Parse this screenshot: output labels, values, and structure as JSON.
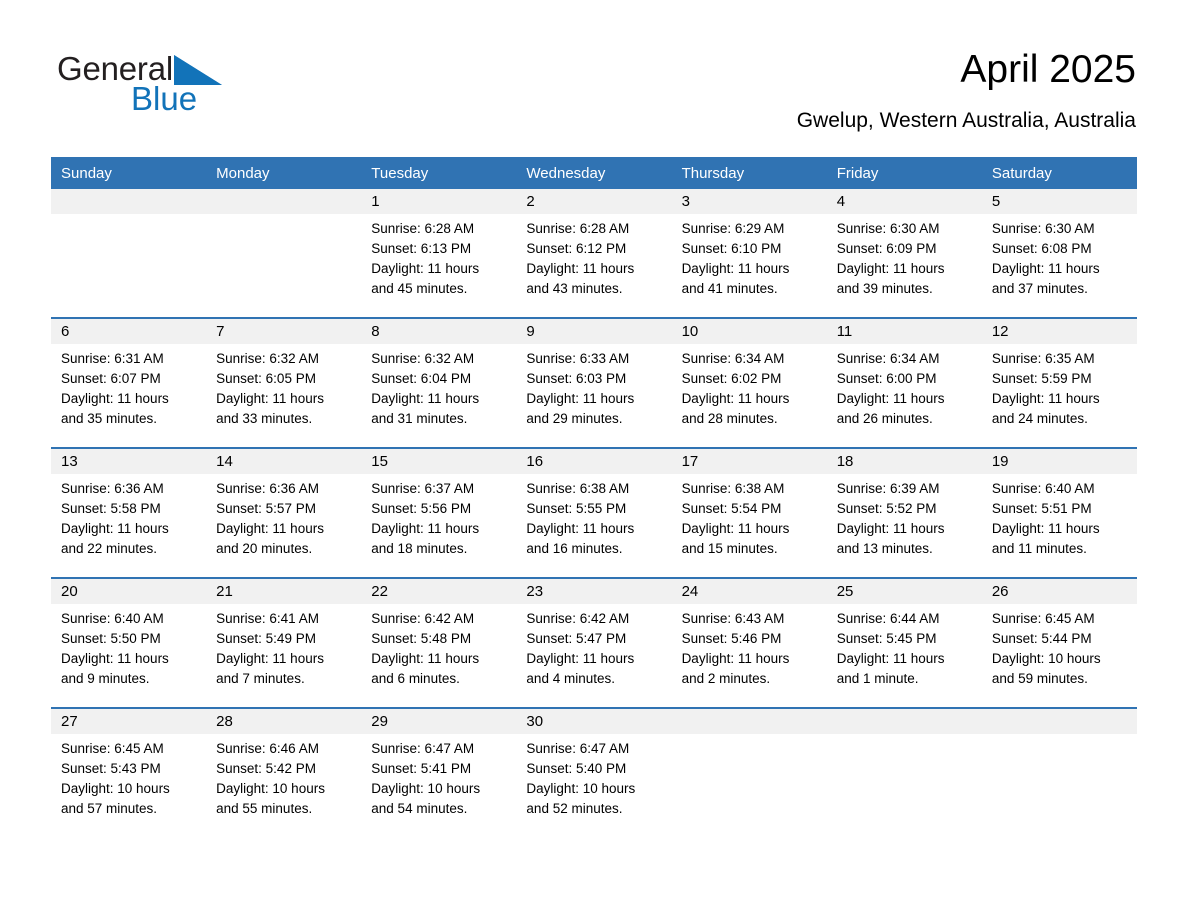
{
  "brand": {
    "name_part1": "General",
    "name_part2": "Blue",
    "triangle_color": "#1273b9",
    "text_color": "#231f20"
  },
  "header": {
    "title": "April 2025",
    "location": "Gwelup, Western Australia, Australia"
  },
  "theme": {
    "header_blue": "#3073b3",
    "daynum_band": "#f1f1f1",
    "separator_blue": "#3073b3"
  },
  "calendar": {
    "weekday_headers": [
      "Sunday",
      "Monday",
      "Tuesday",
      "Wednesday",
      "Thursday",
      "Friday",
      "Saturday"
    ],
    "weeks": [
      [
        {
          "day": "",
          "sunrise": "",
          "sunset": "",
          "daylight": ""
        },
        {
          "day": "",
          "sunrise": "",
          "sunset": "",
          "daylight": ""
        },
        {
          "day": "1",
          "sunrise": "Sunrise: 6:28 AM",
          "sunset": "Sunset: 6:13 PM",
          "daylight": "Daylight: 11 hours and 45 minutes."
        },
        {
          "day": "2",
          "sunrise": "Sunrise: 6:28 AM",
          "sunset": "Sunset: 6:12 PM",
          "daylight": "Daylight: 11 hours and 43 minutes."
        },
        {
          "day": "3",
          "sunrise": "Sunrise: 6:29 AM",
          "sunset": "Sunset: 6:10 PM",
          "daylight": "Daylight: 11 hours and 41 minutes."
        },
        {
          "day": "4",
          "sunrise": "Sunrise: 6:30 AM",
          "sunset": "Sunset: 6:09 PM",
          "daylight": "Daylight: 11 hours and 39 minutes."
        },
        {
          "day": "5",
          "sunrise": "Sunrise: 6:30 AM",
          "sunset": "Sunset: 6:08 PM",
          "daylight": "Daylight: 11 hours and 37 minutes."
        }
      ],
      [
        {
          "day": "6",
          "sunrise": "Sunrise: 6:31 AM",
          "sunset": "Sunset: 6:07 PM",
          "daylight": "Daylight: 11 hours and 35 minutes."
        },
        {
          "day": "7",
          "sunrise": "Sunrise: 6:32 AM",
          "sunset": "Sunset: 6:05 PM",
          "daylight": "Daylight: 11 hours and 33 minutes."
        },
        {
          "day": "8",
          "sunrise": "Sunrise: 6:32 AM",
          "sunset": "Sunset: 6:04 PM",
          "daylight": "Daylight: 11 hours and 31 minutes."
        },
        {
          "day": "9",
          "sunrise": "Sunrise: 6:33 AM",
          "sunset": "Sunset: 6:03 PM",
          "daylight": "Daylight: 11 hours and 29 minutes."
        },
        {
          "day": "10",
          "sunrise": "Sunrise: 6:34 AM",
          "sunset": "Sunset: 6:02 PM",
          "daylight": "Daylight: 11 hours and 28 minutes."
        },
        {
          "day": "11",
          "sunrise": "Sunrise: 6:34 AM",
          "sunset": "Sunset: 6:00 PM",
          "daylight": "Daylight: 11 hours and 26 minutes."
        },
        {
          "day": "12",
          "sunrise": "Sunrise: 6:35 AM",
          "sunset": "Sunset: 5:59 PM",
          "daylight": "Daylight: 11 hours and 24 minutes."
        }
      ],
      [
        {
          "day": "13",
          "sunrise": "Sunrise: 6:36 AM",
          "sunset": "Sunset: 5:58 PM",
          "daylight": "Daylight: 11 hours and 22 minutes."
        },
        {
          "day": "14",
          "sunrise": "Sunrise: 6:36 AM",
          "sunset": "Sunset: 5:57 PM",
          "daylight": "Daylight: 11 hours and 20 minutes."
        },
        {
          "day": "15",
          "sunrise": "Sunrise: 6:37 AM",
          "sunset": "Sunset: 5:56 PM",
          "daylight": "Daylight: 11 hours and 18 minutes."
        },
        {
          "day": "16",
          "sunrise": "Sunrise: 6:38 AM",
          "sunset": "Sunset: 5:55 PM",
          "daylight": "Daylight: 11 hours and 16 minutes."
        },
        {
          "day": "17",
          "sunrise": "Sunrise: 6:38 AM",
          "sunset": "Sunset: 5:54 PM",
          "daylight": "Daylight: 11 hours and 15 minutes."
        },
        {
          "day": "18",
          "sunrise": "Sunrise: 6:39 AM",
          "sunset": "Sunset: 5:52 PM",
          "daylight": "Daylight: 11 hours and 13 minutes."
        },
        {
          "day": "19",
          "sunrise": "Sunrise: 6:40 AM",
          "sunset": "Sunset: 5:51 PM",
          "daylight": "Daylight: 11 hours and 11 minutes."
        }
      ],
      [
        {
          "day": "20",
          "sunrise": "Sunrise: 6:40 AM",
          "sunset": "Sunset: 5:50 PM",
          "daylight": "Daylight: 11 hours and 9 minutes."
        },
        {
          "day": "21",
          "sunrise": "Sunrise: 6:41 AM",
          "sunset": "Sunset: 5:49 PM",
          "daylight": "Daylight: 11 hours and 7 minutes."
        },
        {
          "day": "22",
          "sunrise": "Sunrise: 6:42 AM",
          "sunset": "Sunset: 5:48 PM",
          "daylight": "Daylight: 11 hours and 6 minutes."
        },
        {
          "day": "23",
          "sunrise": "Sunrise: 6:42 AM",
          "sunset": "Sunset: 5:47 PM",
          "daylight": "Daylight: 11 hours and 4 minutes."
        },
        {
          "day": "24",
          "sunrise": "Sunrise: 6:43 AM",
          "sunset": "Sunset: 5:46 PM",
          "daylight": "Daylight: 11 hours and 2 minutes."
        },
        {
          "day": "25",
          "sunrise": "Sunrise: 6:44 AM",
          "sunset": "Sunset: 5:45 PM",
          "daylight": "Daylight: 11 hours and 1 minute."
        },
        {
          "day": "26",
          "sunrise": "Sunrise: 6:45 AM",
          "sunset": "Sunset: 5:44 PM",
          "daylight": "Daylight: 10 hours and 59 minutes."
        }
      ],
      [
        {
          "day": "27",
          "sunrise": "Sunrise: 6:45 AM",
          "sunset": "Sunset: 5:43 PM",
          "daylight": "Daylight: 10 hours and 57 minutes."
        },
        {
          "day": "28",
          "sunrise": "Sunrise: 6:46 AM",
          "sunset": "Sunset: 5:42 PM",
          "daylight": "Daylight: 10 hours and 55 minutes."
        },
        {
          "day": "29",
          "sunrise": "Sunrise: 6:47 AM",
          "sunset": "Sunset: 5:41 PM",
          "daylight": "Daylight: 10 hours and 54 minutes."
        },
        {
          "day": "30",
          "sunrise": "Sunrise: 6:47 AM",
          "sunset": "Sunset: 5:40 PM",
          "daylight": "Daylight: 10 hours and 52 minutes."
        },
        {
          "day": "",
          "sunrise": "",
          "sunset": "",
          "daylight": ""
        },
        {
          "day": "",
          "sunrise": "",
          "sunset": "",
          "daylight": ""
        },
        {
          "day": "",
          "sunrise": "",
          "sunset": "",
          "daylight": ""
        }
      ]
    ]
  }
}
